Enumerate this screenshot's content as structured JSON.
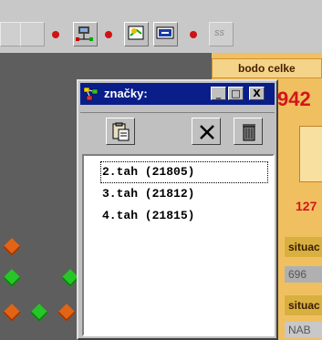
{
  "toolbar": {
    "icons": [
      "tool-disabled-icon",
      "pc-node-icon",
      "arrow-node-icon",
      "screen-icon",
      "ss-disabled-icon"
    ],
    "disabled_label": "ss"
  },
  "window": {
    "title": "značky:",
    "title_icon": "tree-icon",
    "buttons": {
      "minimize": "_",
      "restore": "□",
      "close": "X"
    },
    "toolbar": [
      "paste-icon",
      "delete-x-icon",
      "trash-icon"
    ],
    "items": [
      {
        "label": "2.tah (21805)",
        "selected": true
      },
      {
        "label": "3.tah (21812)",
        "selected": false
      },
      {
        "label": "4.tah (21815)",
        "selected": false
      }
    ]
  },
  "right_panel": {
    "header": "bodo celke",
    "big_number": "942",
    "red_number": "127",
    "situace1": "situac",
    "gray_value": "696",
    "situace2": "situac",
    "bottom": "NAB"
  },
  "colors": {
    "title_bar": "#0a1e8a",
    "workspace": "#5e5e5e",
    "accent_red": "#d4141e",
    "panel": "#f0c060"
  }
}
